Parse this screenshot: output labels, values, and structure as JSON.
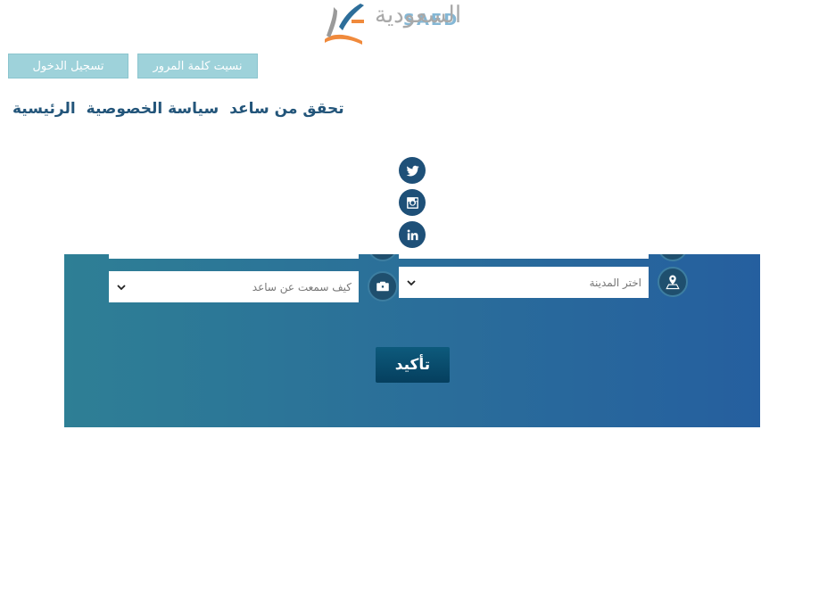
{
  "logo": {
    "arabic_text": "السعودية",
    "latin_text": "SAED",
    "icon": "pen-book-logo-icon"
  },
  "header": {
    "login_label": "تسجيل الدخول",
    "forgot_password_label": "نسيت كلمة المرور"
  },
  "nav": {
    "items": [
      {
        "label": "الرئيسية"
      },
      {
        "label": "سياسة الخصوصية"
      },
      {
        "label": "تحقق من ساعد"
      }
    ]
  },
  "social": [
    {
      "icon": "twitter-icon"
    },
    {
      "icon": "instagram-icon"
    },
    {
      "icon": "linkedin-icon"
    }
  ],
  "form": {
    "city_select": {
      "placeholder": "اختر المدينة",
      "icon": "map-pin-icon"
    },
    "source_select": {
      "placeholder": "كيف سمعت عن ساعد",
      "icon": "briefcase-icon"
    },
    "confirm_label": "تأكيد"
  },
  "colors": {
    "nav_text": "#23557a",
    "top_button": "#9ed2da",
    "panel_start": "#2e7f95",
    "panel_end": "#255f9f",
    "confirm_button": "#0d5a7c"
  }
}
